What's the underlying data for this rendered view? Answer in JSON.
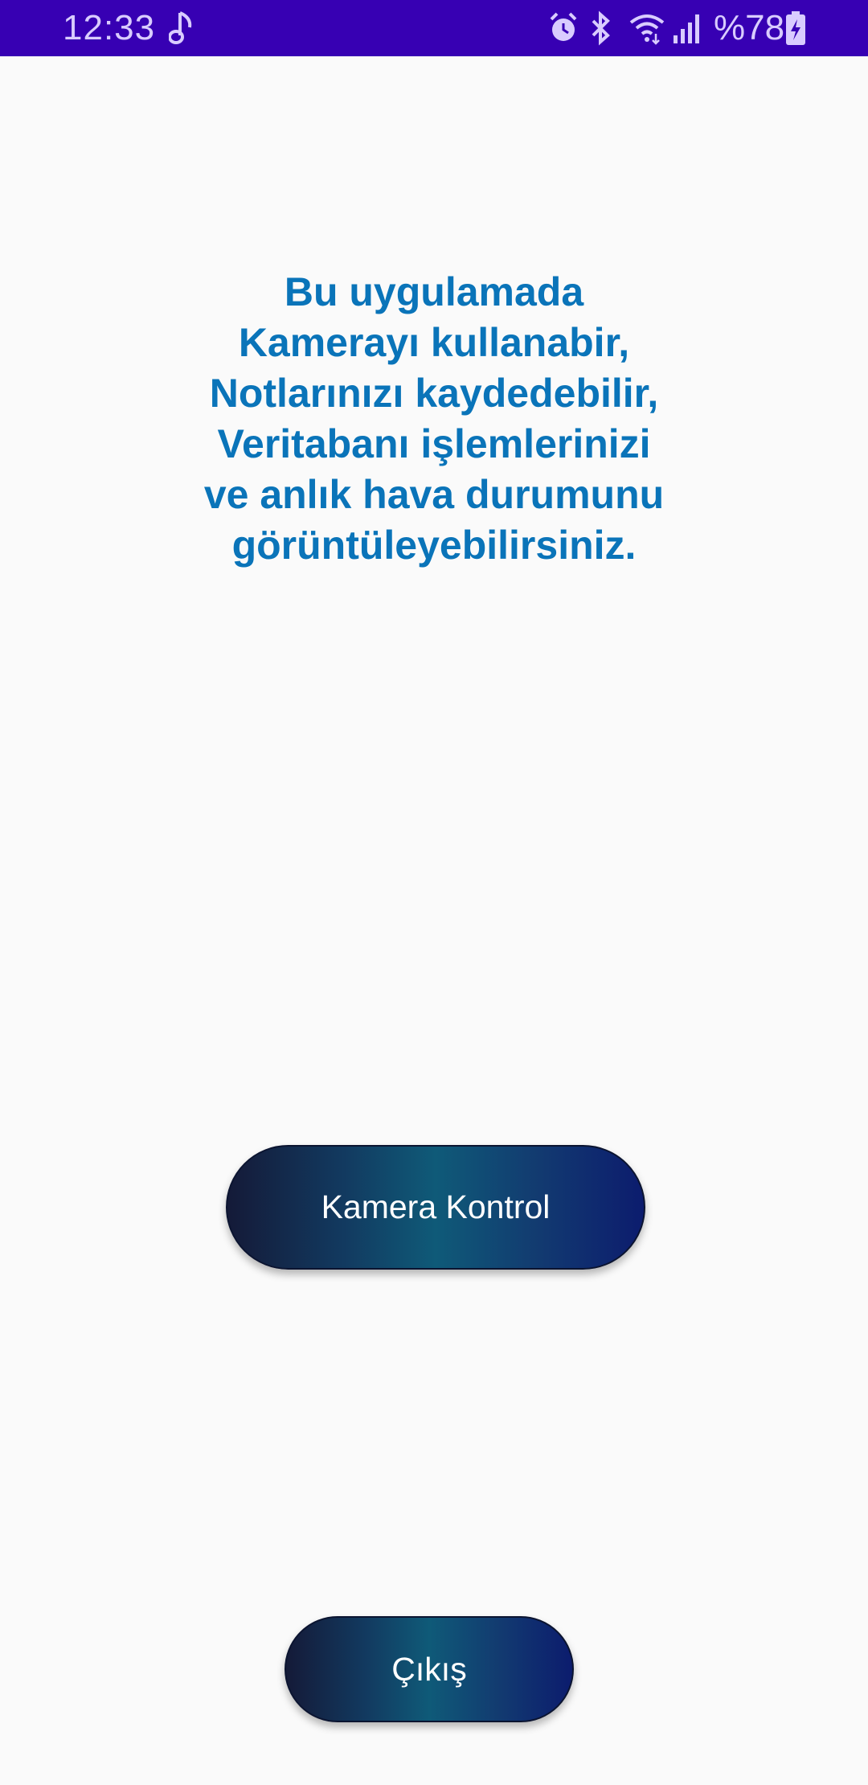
{
  "status_bar": {
    "time": "12:33",
    "battery": "%78",
    "background_color": "#3700b3",
    "icons": [
      "music-note-icon",
      "alarm-icon",
      "bluetooth-icon",
      "wifi-icon",
      "signal-icon",
      "battery-charging-icon"
    ]
  },
  "main": {
    "info_text": "Bu uygulamada\nKamerayı kullanabir,\nNotlarınızı kaydedebilir,\nVeritabanı işlemlerinizi\nve anlık hava durumunu\ngörüntüleyebilirsiniz.",
    "text_color": "#0a74b9",
    "camera_button_label": "Kamera Kontrol",
    "exit_button_label": "Çıkış"
  }
}
